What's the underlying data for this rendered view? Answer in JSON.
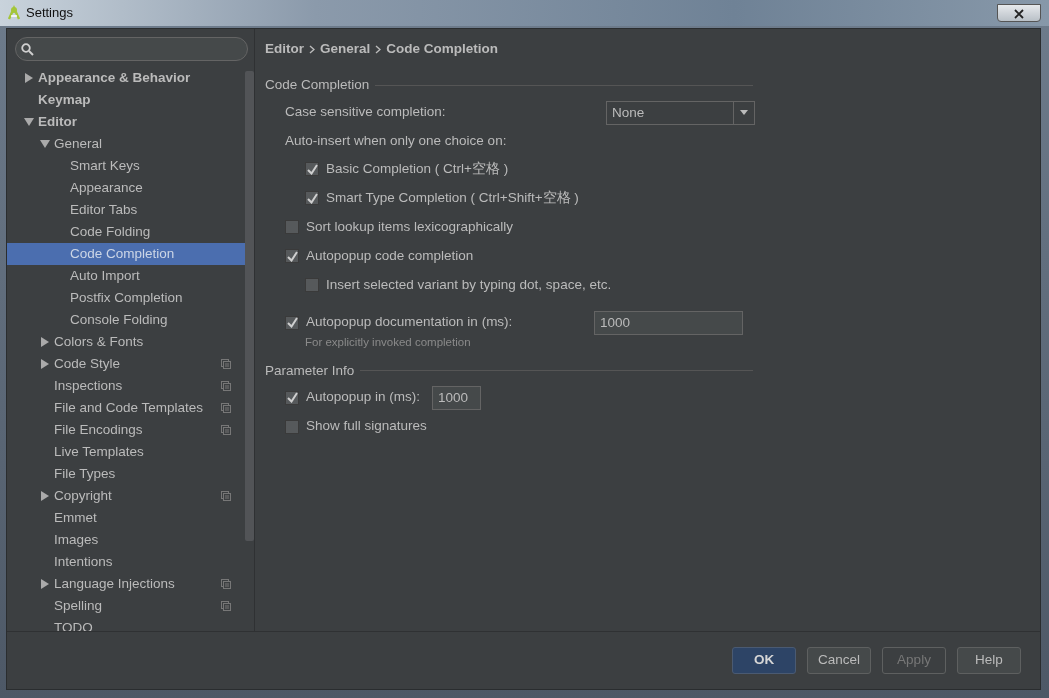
{
  "window": {
    "title": "Settings"
  },
  "tree": [
    {
      "label": "Appearance & Behavior",
      "expanded": false,
      "selected": false,
      "bold": true,
      "per_project": false
    },
    {
      "label": "Keymap",
      "selected": false,
      "bold": true,
      "per_project": false
    },
    {
      "label": "Editor",
      "expanded": true,
      "selected": false,
      "bold": true,
      "per_project": false,
      "children": [
        {
          "label": "General",
          "expanded": true,
          "selected": false,
          "bold": false,
          "per_project": false,
          "children": [
            {
              "label": "Smart Keys",
              "selected": false,
              "bold": false,
              "per_project": false
            },
            {
              "label": "Appearance",
              "selected": false,
              "bold": false,
              "per_project": false
            },
            {
              "label": "Editor Tabs",
              "selected": false,
              "bold": false,
              "per_project": false
            },
            {
              "label": "Code Folding",
              "selected": false,
              "bold": false,
              "per_project": false
            },
            {
              "label": "Code Completion",
              "selected": true,
              "bold": false,
              "per_project": false
            },
            {
              "label": "Auto Import",
              "selected": false,
              "bold": false,
              "per_project": false
            },
            {
              "label": "Postfix Completion",
              "selected": false,
              "bold": false,
              "per_project": false
            },
            {
              "label": "Console Folding",
              "selected": false,
              "bold": false,
              "per_project": false
            }
          ]
        },
        {
          "label": "Colors & Fonts",
          "expanded": false,
          "selected": false,
          "bold": false,
          "per_project": false
        },
        {
          "label": "Code Style",
          "expanded": false,
          "selected": false,
          "bold": false,
          "per_project": true
        },
        {
          "label": "Inspections",
          "selected": false,
          "bold": false,
          "per_project": true
        },
        {
          "label": "File and Code Templates",
          "selected": false,
          "bold": false,
          "per_project": true
        },
        {
          "label": "File Encodings",
          "selected": false,
          "bold": false,
          "per_project": true
        },
        {
          "label": "Live Templates",
          "selected": false,
          "bold": false,
          "per_project": false
        },
        {
          "label": "File Types",
          "selected": false,
          "bold": false,
          "per_project": false
        },
        {
          "label": "Copyright",
          "expanded": false,
          "selected": false,
          "bold": false,
          "per_project": true
        },
        {
          "label": "Emmet",
          "selected": false,
          "bold": false,
          "per_project": false
        },
        {
          "label": "Images",
          "selected": false,
          "bold": false,
          "per_project": false
        },
        {
          "label": "Intentions",
          "selected": false,
          "bold": false,
          "per_project": false
        },
        {
          "label": "Language Injections",
          "expanded": false,
          "selected": false,
          "bold": false,
          "per_project": true
        },
        {
          "label": "Spelling",
          "selected": false,
          "bold": false,
          "per_project": true
        },
        {
          "label": "TODO",
          "selected": false,
          "bold": false,
          "per_project": false
        }
      ]
    }
  ],
  "breadcrumb": [
    "Editor",
    "General",
    "Code Completion"
  ],
  "sections": [
    {
      "title": "Code Completion",
      "rows": [
        {
          "kind": "select",
          "label": "Case sensitive completion:",
          "value": "None"
        },
        {
          "kind": "label",
          "label": "Auto-insert when only one choice on:",
          "children": [
            {
              "kind": "checkbox",
              "label": "Basic Completion ( Ctrl+空格 )",
              "checked": true
            },
            {
              "kind": "checkbox",
              "label": "Smart Type Completion ( Ctrl+Shift+空格 )",
              "checked": true
            }
          ]
        },
        {
          "kind": "checkbox",
          "label": "Sort lookup items lexicographically",
          "checked": false
        },
        {
          "kind": "checkbox",
          "label": "Autopopup code completion",
          "checked": true,
          "children": [
            {
              "kind": "checkbox",
              "label": "Insert selected variant by typing dot, space, etc.",
              "checked": false
            }
          ]
        },
        {
          "kind": "checkbox_field",
          "label": "Autopopup documentation in (ms):",
          "checked": true,
          "value": "1000",
          "hint": "For explicitly invoked completion"
        }
      ]
    },
    {
      "title": "Parameter Info",
      "rows": [
        {
          "kind": "checkbox_inline",
          "label": "Autopopup in (ms):",
          "checked": true,
          "value": "1000"
        },
        {
          "kind": "checkbox",
          "label": "Show full signatures",
          "checked": false
        }
      ]
    }
  ],
  "buttons": [
    {
      "label": "OK",
      "default": true,
      "disabled": false
    },
    {
      "label": "Cancel",
      "default": false,
      "disabled": false
    },
    {
      "label": "Apply",
      "default": false,
      "disabled": true
    },
    {
      "label": "Help",
      "default": false,
      "disabled": false
    }
  ]
}
